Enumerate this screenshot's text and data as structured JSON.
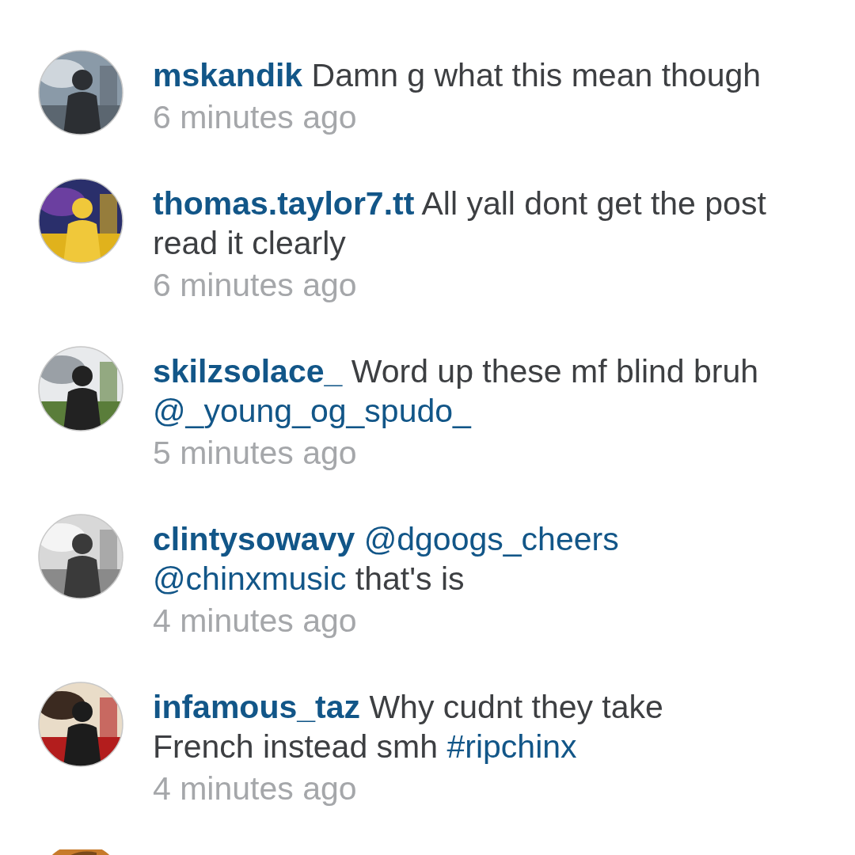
{
  "comments": [
    {
      "avatar": {
        "kind": "picture"
      },
      "username": "mskandik",
      "parts": [
        {
          "kind": "text",
          "text": "Damn g what this mean though"
        }
      ],
      "time": "6 minutes ago"
    },
    {
      "avatar": {
        "kind": "picture"
      },
      "username": "thomas.taylor7.tt",
      "parts": [
        {
          "kind": "text",
          "text": "All yall dont get the post read it clearly"
        }
      ],
      "time": "6 minutes ago"
    },
    {
      "avatar": {
        "kind": "picture"
      },
      "username": "skilzsolace_",
      "parts": [
        {
          "kind": "text",
          "text": "Word up these mf blind bruh"
        },
        {
          "kind": "mention",
          "text": "@_young_og_spudo_"
        }
      ],
      "time": "5 minutes ago"
    },
    {
      "avatar": {
        "kind": "picture"
      },
      "username": "clintysowavy",
      "parts": [
        {
          "kind": "mention",
          "text": "@dgoogs_cheers"
        },
        {
          "kind": "mention",
          "text": "@chinxmusic"
        },
        {
          "kind": "text",
          "text": "that's is"
        }
      ],
      "time": "4 minutes ago"
    },
    {
      "avatar": {
        "kind": "picture"
      },
      "username": "infamous_taz",
      "parts": [
        {
          "kind": "text",
          "text": "Why cudnt they take French instead smh"
        },
        {
          "kind": "hashtag",
          "text": "#ripchinx"
        }
      ],
      "time": "4 minutes ago"
    }
  ],
  "next_avatar": {
    "kind": "picture"
  }
}
